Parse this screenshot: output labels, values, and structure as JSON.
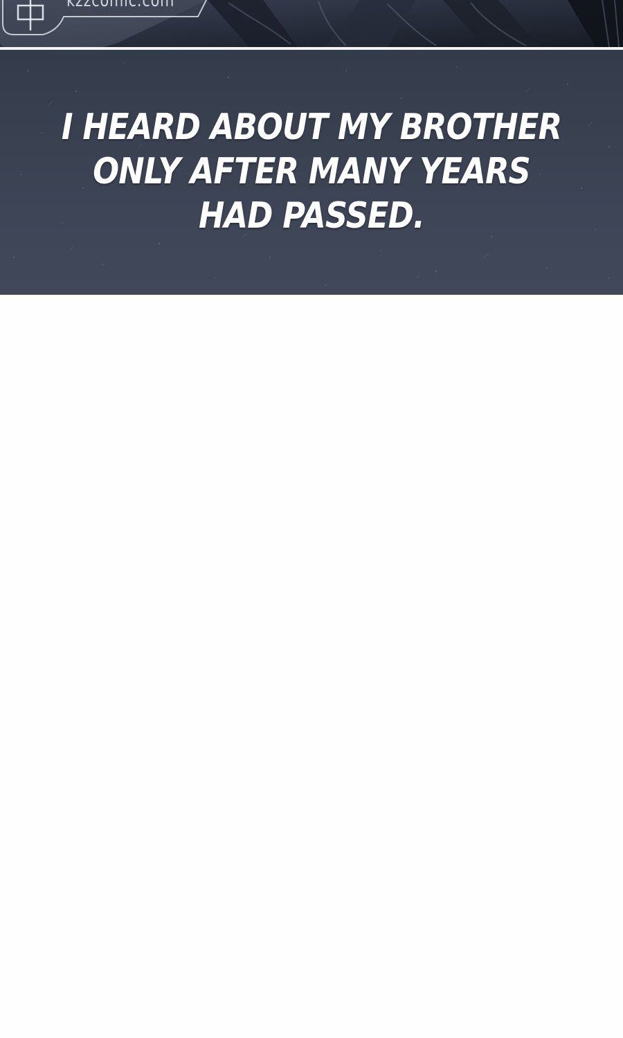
{
  "watermark": {
    "text": "kzzcomic.com"
  },
  "narration": {
    "lines": [
      "I HEARD ABOUT MY BROTHER",
      "ONLY AFTER MANY YEARS",
      "HAD PASSED."
    ]
  },
  "colors": {
    "panel_background": "#3a4252",
    "narration_text": "#ffffff",
    "page_background": "#fefefe"
  }
}
